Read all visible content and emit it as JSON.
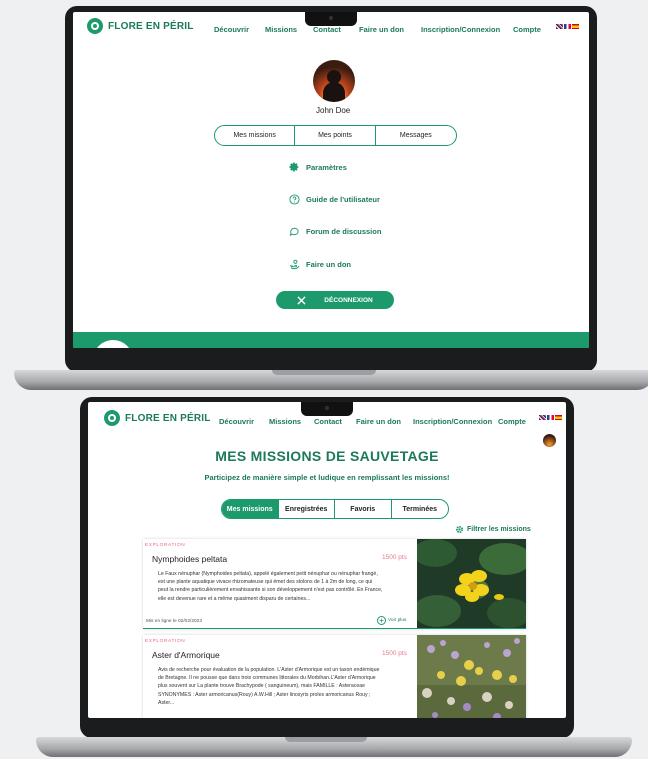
{
  "brand": {
    "name": "FLORE EN PÉRIL"
  },
  "nav": {
    "items": [
      "Découvrir",
      "Missions",
      "Contact",
      "Faire un don",
      "Inscription/Connexion",
      "Compte"
    ]
  },
  "profile": {
    "user_name": "John Doe",
    "tabs": [
      "Mes missions",
      "Mes points",
      "Messages"
    ],
    "menu": [
      {
        "icon": "gear-icon",
        "label": "Paramètres"
      },
      {
        "icon": "help-circle-icon",
        "label": "Guide de l'utilisateur"
      },
      {
        "icon": "chat-bubble-icon",
        "label": "Forum de discussion"
      },
      {
        "icon": "donate-hand-icon",
        "label": "Faire un don"
      }
    ],
    "logout_label": "DÉCONNEXION"
  },
  "missions": {
    "title": "MES  MISSIONS DE SAUVETAGE",
    "subtitle": "Participez de manière simple et ludique en remplissant les missions!",
    "tabs": [
      "Mes missions",
      "Enregistrées",
      "Favoris",
      "Terminées"
    ],
    "active_tab": "Mes missions",
    "filter_label": "Filtrer les missions",
    "cards": [
      {
        "category": "EXPLORATION",
        "title": "Nymphoides peltata",
        "points": "1500 pts",
        "description": "Le Faux nénuphar (Nymphoides peltata), appelé également petit nénuphar ou nénuphar frangé, est une plante aquatique vivace rhizomateuse qui émet des stolons de 1 à 2m de long, ce qui peut la rendre particulièrement envahissante si son développement n'est pas contrôlé. En France, elle est devenue rare et a même quasiment disparu de certaines...",
        "date": "Mis en ligne le 02/02/2023",
        "more_label": "Voir plus"
      },
      {
        "category": "EXPLORATION",
        "title": "Aster d'Armorique",
        "points": "1500 pts",
        "description": "Avis de recherche pour évaluation de la population. L'Aster d'Armorique est un taxon endémique de Bretagne. Il ne pousse que dans trois communes littorales du Morbihan.L'Aster d'Armorique plus souvent sur La plante trouve Brachypode ( sanguineum), mais FAMILLE : Asteraceae SYNONYMES : Aster armoricanus(Rouy) A.W.Hill ; Aster linosyris proles armoricanus Rouy ; Aster..."
      }
    ]
  },
  "colors": {
    "accent": "#1d9a6c",
    "accent_dark": "#1c7a58",
    "points": "#e57b88"
  }
}
